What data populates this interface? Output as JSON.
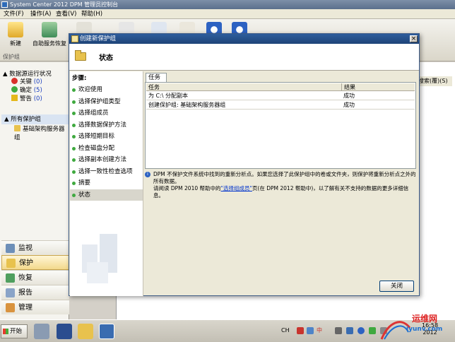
{
  "app": {
    "title": "System Center 2012 DPM 管理员控制台",
    "menu": [
      "文件(F)",
      "操作(A)",
      "查看(V)",
      "帮助(H)"
    ],
    "toolbar": {
      "new_label": "新建",
      "self_service_label": "自助服务恢复",
      "group_label": "保护组"
    }
  },
  "nav": {
    "status_head": "数据源运行状况",
    "status_items": [
      {
        "label": "关键",
        "count": "(0)",
        "icon": "critical-icon",
        "color": "#d9302b"
      },
      {
        "label": "确定",
        "count": "(5)",
        "icon": "ok-icon",
        "color": "#3fa93f"
      },
      {
        "label": "警告",
        "count": "(0)",
        "icon": "warning-icon",
        "color": "#e5b81c"
      }
    ],
    "groups_head": "所有保护组",
    "group_item": "基础架构服务器组",
    "wunderbar": [
      {
        "label": "监视",
        "icon": "monitor-icon"
      },
      {
        "label": "保护",
        "icon": "protect-icon"
      },
      {
        "label": "恢复",
        "icon": "recovery-icon"
      },
      {
        "label": "报告",
        "icon": "report-icon"
      },
      {
        "label": "管理",
        "icon": "management-icon"
      }
    ],
    "selected_wunderbar": "保护"
  },
  "right_pane": {
    "column_fragment": "搜索(覆)(S)"
  },
  "dialog": {
    "title": "创建新保护组",
    "header_title": "状态",
    "steps_head": "步骤:",
    "steps": [
      "欢迎使用",
      "选择保护组类型",
      "选择组成员",
      "选择数据保护方法",
      "选择短期目标",
      "检查磁盘分配",
      "选择副本创建方法",
      "选择一致性检查选项",
      "摘要",
      "状态"
    ],
    "selected_step": "状态",
    "tab_label": "任务",
    "grid": {
      "columns": [
        "任务",
        "结果"
      ],
      "rows": [
        {
          "task": "为 C:\\ 分配副本",
          "result": "成功"
        },
        {
          "task": "创建保护组: 基础架构服务器组",
          "result": "成功"
        }
      ]
    },
    "info": {
      "line1": "DPM 不保护文件系统中找到的重新分析点。如果您选择了此保护组中的卷或文件夹，则保护将重新分析点之外的所有数据。",
      "line2_prefix": "请阅读 DPM 2010 帮助中的",
      "line2_link": "\"选择组成员\"",
      "line2_suffix": "页(在 DPM 2012 帮助中)，以了解有关不支持的数据的更多详细信息。"
    },
    "close_button": "关闭"
  },
  "taskbar": {
    "start_label": "开始",
    "tray_lang": "CH",
    "tray_ime": "中",
    "clock_time": "16:58",
    "clock_date": "2012"
  },
  "watermark": {
    "line1": "运维网",
    "line2": "iyunv.com"
  }
}
